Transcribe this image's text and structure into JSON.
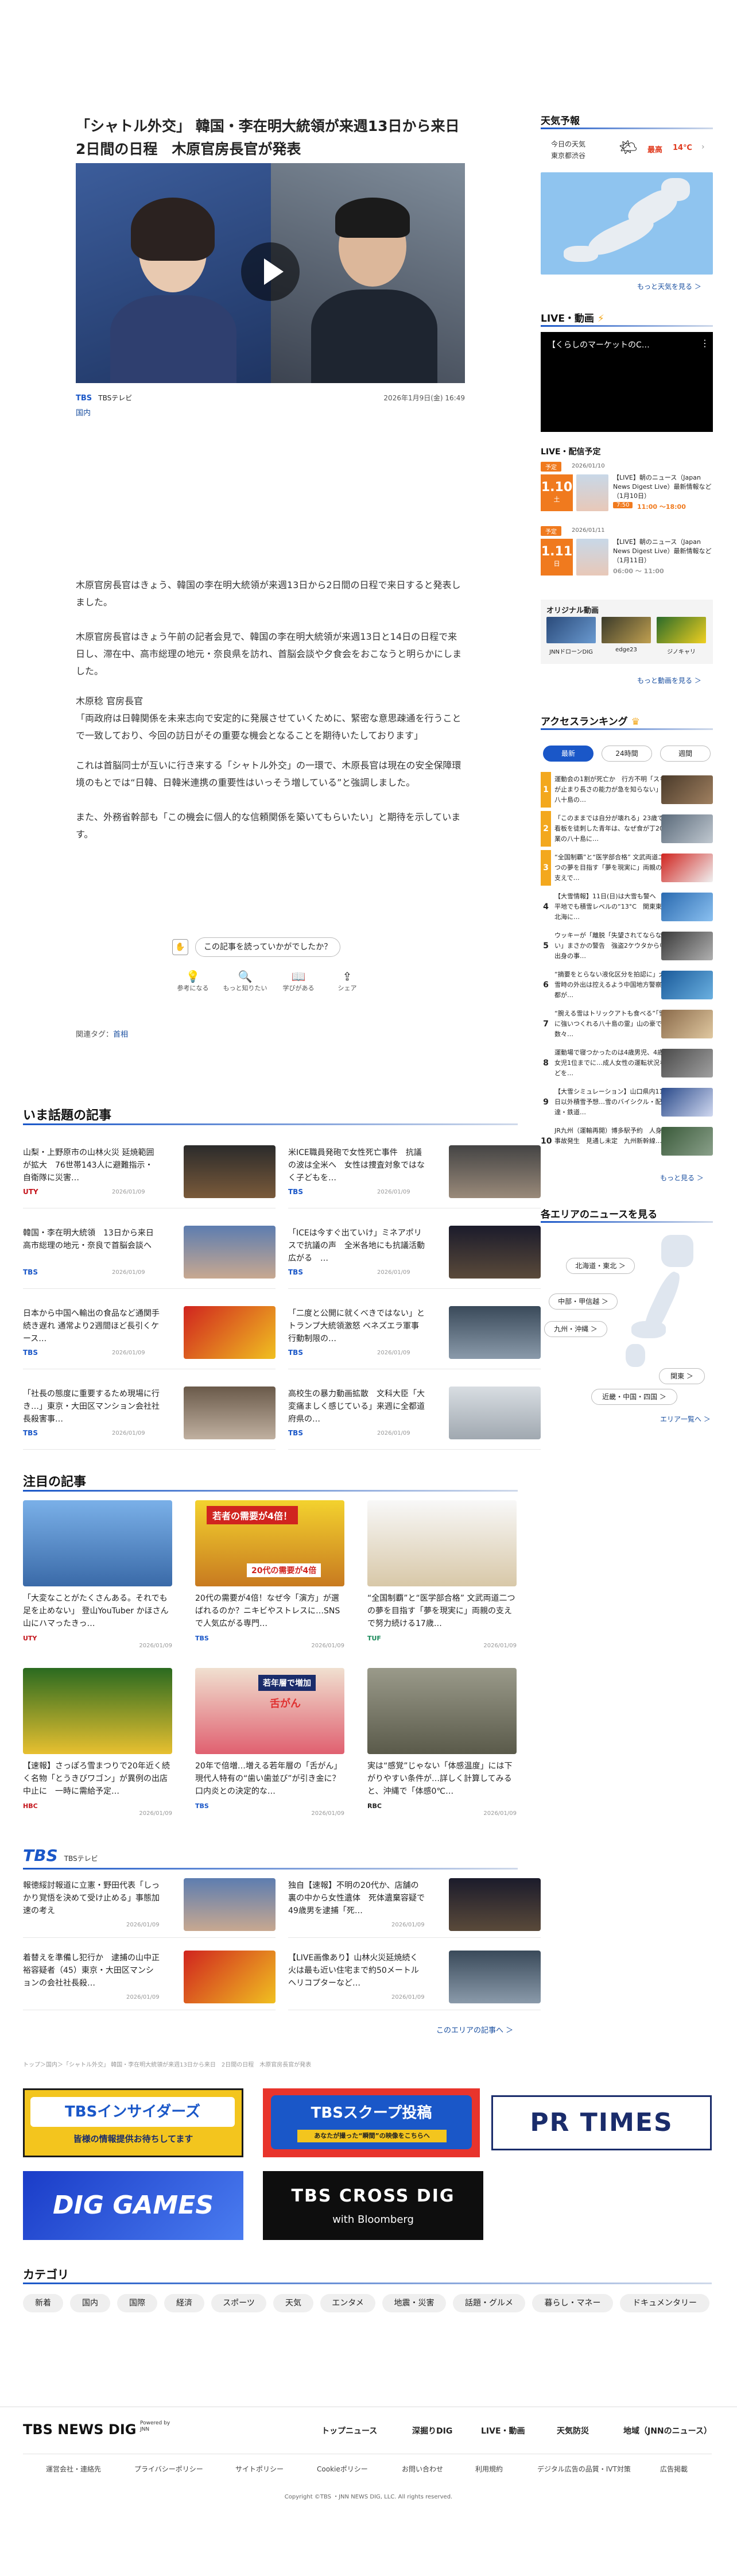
{
  "article": {
    "title": "「シャトル外交」 韓国・李在明大統領が来週13日から来日　2日間の日程　木原官房長官が発表",
    "source_logo": "TBS",
    "source_name": "TBSテレビ",
    "date": "2026年1月9日(金) 16:49",
    "category": "国内",
    "paragraphs": [
      "木原官房長官はきょう、韓国の李在明大統領が来週13日から2日間の日程で来日すると発表しました。",
      "木原官房長官はきょう午前の記者会見で、韓国の李在明大統領が来週13日と14日の日程で来日し、滞在中、高市総理の地元・奈良県を訪れ、首脳会談や夕食会をおこなうと明らかにしました。",
      "木原稔 官房長官\n「両政府は日韓関係を未来志向で安定的に発展させていくために、緊密な意思疎通を行うことで一致しており、今回の訪日がその重要な機会となることを期待いたしております」",
      "これは首脳同士が互いに行き来する「シャトル外交」の一環で、木原長官は現在の安全保障環境のもとでは“日韓、日韓米連携の重要性はいっそう増している”と強調しました。",
      "また、外務省幹部も「この機会に個人的な信頼関係を築いてもらいたい」と期待を示しています。"
    ],
    "feedback_prompt": "この記事を読っていかがでしたか？",
    "reactions": [
      "参考になる",
      "もっと知りたい",
      "学びがある",
      "シェア"
    ],
    "tags_label": "関連タグ：",
    "tag": "首相"
  },
  "trending": {
    "title": "いま話題の記事",
    "items": [
      {
        "t": "山梨・上野原市の山林火災 延焼範囲が拡大　76世帯143人に避難指示・自衛隊に災害…",
        "s": "UTY",
        "d": "2026/01/09"
      },
      {
        "t": "米ICE職員発砲で女性死亡事件　抗議の波は全米へ　女性は捜査対象ではなく子どもを…",
        "s": "TBS",
        "d": "2026/01/09"
      },
      {
        "t": "韓国・李在明大統領　13日から来日　高市総理の地元・奈良で首脳会談へ",
        "s": "TBS",
        "d": "2026/01/09"
      },
      {
        "t": "「ICEは今すぐ出ていけ」ミネアポリスで抗議の声　全米各地にも抗議活動広がる　…",
        "s": "TBS",
        "d": "2026/01/09"
      },
      {
        "t": "日本から中国へ輸出の食品など通関手続き遅れ 通常より2週間ほど長引くケース…",
        "s": "TBS",
        "d": "2026/01/09"
      },
      {
        "t": "「二度と公開に就くべきではない」とトランプ大統領激怒 ベネズエラ軍事行動制限の…",
        "s": "TBS",
        "d": "2026/01/09"
      },
      {
        "t": "「社長の態度に重要するため現場に行き…」東京・大田区マンション会社社長殺害事…",
        "s": "TBS",
        "d": "2026/01/09"
      },
      {
        "t": "高校生の暴力動画拡散　文科大臣「大変痛ましく感じている」来週に全都道府県の…",
        "s": "TBS",
        "d": "2026/01/09"
      }
    ]
  },
  "featured": {
    "title": "注目の記事",
    "items": [
      {
        "t": "「大変なことがたくさんある。それでも足を止めない」 登山YouTuber かほさん　山にハマったきっ…",
        "s": "UTY",
        "d": "2026/01/09"
      },
      {
        "t": "20代の需要が4倍！なぜ今「演方」が選ばれるのか？ニキビやストレスに…SNSで人気広がる専門…",
        "s": "TBS",
        "d": "2026/01/09"
      },
      {
        "t": "“全国制覇”と“医学部合格” 文武両道二つの夢を目指す「夢を現実に」両親の支えで努力続ける17歳…",
        "s": "TUF",
        "d": "2026/01/09"
      },
      {
        "t": "【速報】さっぽろ雪まつりで20年近く続く名物「とうきびワゴン」が異例の出店中止に　一時に需給予定…",
        "s": "HBC",
        "d": "2026/01/09"
      },
      {
        "t": "20年で倍増…増える若年層の「舌がん」 現代人特有の“歯い歯並び”が引き金に？口内炎との決定的な…",
        "s": "TBS",
        "d": "2026/01/09"
      },
      {
        "t": "実は“感覚”じゃない「体感温度」には下がりやすい条件が…詳しく計算してみると、沖縄で「体感0℃…",
        "s": "RBC",
        "d": "2026/01/09"
      }
    ],
    "banner_texts": [
      "若者の需要が4倍！",
      "20代の需要が4倍",
      "若年層で増加",
      "舌がん"
    ]
  },
  "tbs_section": {
    "logo": "TBS",
    "sub": "TBSテレビ",
    "items": [
      {
        "t": "報徳綏討報道に立憲・野田代表「しっかり覚悟を決めて受け止める」事態加速の考え",
        "d": "2026/01/09"
      },
      {
        "t": "独自【速報】不明の20代か、店舗の裏の中から女性遺体　死体遺棄容疑で49歳男を逮捕「死…",
        "d": "2026/01/09"
      },
      {
        "t": "着替えを準備し犯行か　逮捕の山中正裕容疑者（45）東京・大田区マンションの会社社長殺…",
        "d": "2026/01/09"
      },
      {
        "t": "【LIVE画像あり】山林火災延焼続く　火は最も近い住宅まで約50メートル　ヘリコプターなど…",
        "d": "2026/01/09"
      }
    ],
    "more": "このエリアの記事へ ＞"
  },
  "breadcrumb": "トップ＞国内＞「シャトル外交」 韓国・李在明大統領が来週13日から来日　2日間の日程　木原官房長官が発表",
  "banners": {
    "insiders_title": "TBSインサイダーズ",
    "insiders_sub": "皆様の情報提供お待ちしてます",
    "scoop_title": "TBSスクープ投稿",
    "scoop_sub": "あなたが撮った“瞬間”の映像をこちらへ",
    "prtimes": "PR TIMES",
    "diggames": "DIG GAMES",
    "crossdig": "TBS CROSS DIG",
    "crossdig_sub": "with Bloomberg"
  },
  "categories": {
    "title": "カテゴリ",
    "items": [
      "新着",
      "国内",
      "国際",
      "経済",
      "スポーツ",
      "天気",
      "エンタメ",
      "地震・災害",
      "話題・グルメ",
      "暮らし・マネー",
      "ドキュメンタリー"
    ]
  },
  "footer": {
    "logo": "TBS NEWS DIG",
    "powered": "Powered by JNN",
    "nav": [
      "トップニュース",
      "深掘りDIG",
      "LIVE・動画",
      "天気防災",
      "地域（JNNのニュース）"
    ],
    "links": [
      "運営会社・連絡先",
      "プライバシーポリシー",
      "サイトポリシー",
      "Cookieポリシー",
      "お問い合わせ",
      "利用規約",
      "デジタル広告の品質・IVT対策",
      "広告掲載"
    ],
    "copyright": "Copyright ©TBS ・JNN NEWS DIG, LLC. All rights reserved."
  },
  "sidebar": {
    "weather": {
      "title": "天気予報",
      "today": "今日の天気",
      "place": "東京都渋谷",
      "max_label": "最高",
      "max": "14℃",
      "more": "もっと天気を見る ＞"
    },
    "live": {
      "title": "LIVE・動画",
      "player_text": "【くらしのマーケットのC…",
      "schedule_title": "LIVE・配信予定",
      "sched": [
        {
          "badge": "予定",
          "date_s": "2026/01/10",
          "day": "1.10",
          "dow": "土",
          "t": "【LIVE】朝のニュース（Japan News Digest Live）最新情報など（1月10日）",
          "tag": "7:50",
          "time": "11:00 〜18:00"
        },
        {
          "badge": "予定",
          "date_s": "2026/01/11",
          "day": "1.11",
          "dow": "日",
          "t": "【LIVE】朝のニュース（Japan News Digest Live）最新情報など（1月11日）",
          "time": "06:00 〜 11:00"
        }
      ],
      "orig_title": "オリジナル動画",
      "orig": [
        "JNNドローンDIG",
        "edge23",
        "ジノキャリ"
      ],
      "more": "もっと動画を見る ＞"
    },
    "ranking": {
      "title": "アクセスランキング",
      "tabs": [
        "最新",
        "24時間",
        "週間"
      ],
      "items": [
        "運動会の1割が死亡か　行方不明「スキが止まり長さの能力が急を知らない」八十島の…",
        "「このままでは自分が壊れる」23歳で看板を徒刺した青年は、なぜ食が丁20業の八十島に…",
        "“全国制覇”と“医学部合格” 文武両道二つの夢を目指す「夢を現実に」両親の支えで…",
        "【大雪情報】11日(日)は大雪も警へ　平地でも積雪レベルの“13°C　関東東北海に…",
        "ウッキーが「離脱「失望されてならない」まさかの警告　強盗2ケウタから中出身の事…",
        "“摘要をとらない液化区分を拍認に」大雪時の外出は控えるよう中国地方警察都が…",
        "“腕える雪はトリックアトも食べる”「雪に強いつくれる八十島の霊」山の豪で数々…",
        "運動場で寝つかったのは4歳男児、4歳女児1位までに…成人女性の運転状況などを…",
        "【大雪シミュレーション】山口県内11日以外積雪予想…雪のバイシクル・配達・鉄道…",
        "JR九州（運輸再開）博多駅予約　人身事故発生　見通し未定　九州新幹線…"
      ],
      "more": "もっと見る ＞"
    },
    "areas": {
      "title": "各エリアのニュースを見る",
      "list": [
        "北海道・東北 ＞",
        "中部・甲信越 ＞",
        "九州・沖縄 ＞",
        "関東 ＞",
        "近畿・中国・四国 ＞"
      ],
      "more": "エリア一覧へ ＞"
    }
  }
}
